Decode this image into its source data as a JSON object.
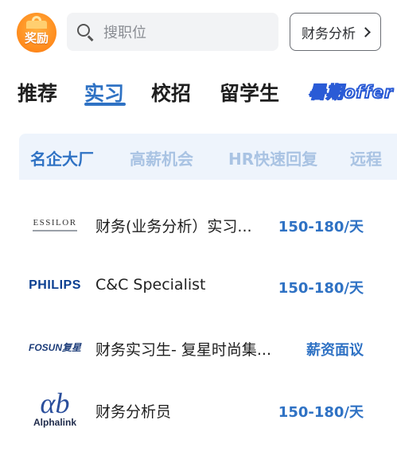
{
  "header": {
    "reward_label": "奖励",
    "search_placeholder": "搜职位",
    "filter_label": "财务分析"
  },
  "tabs": [
    {
      "label": "推荐",
      "active": false
    },
    {
      "label": "实习",
      "active": true
    },
    {
      "label": "校招",
      "active": false
    },
    {
      "label": "留学生",
      "active": false
    }
  ],
  "summer_badge": "暑期offer",
  "subtabs": [
    {
      "label": "名企大厂",
      "active": true
    },
    {
      "label": "高薪机会",
      "active": false
    },
    {
      "label": "HR快速回复",
      "active": false
    },
    {
      "label": "远程",
      "active": false
    }
  ],
  "jobs": [
    {
      "company_logo_text": "ESSILOR",
      "title": "财务(业务分析）实习...",
      "salary": "150-180/天"
    },
    {
      "company_logo_text": "PHILIPS",
      "title": "C&C Specialist",
      "salary": "150-180/天"
    },
    {
      "company_logo_text": "FOSUN复星",
      "title": "财务实习生- 复星时尚集...",
      "salary": "薪资面议"
    },
    {
      "company_logo_text": "Alphalink",
      "logo_mark": "αb",
      "title": "财务分析员",
      "salary": "150-180/天"
    }
  ],
  "colors": {
    "accent": "#2f72c4",
    "subtab_bg": "#eef4fc",
    "subtab_inactive": "#a9c3e3",
    "reward_orange": "#ff8a1c"
  }
}
